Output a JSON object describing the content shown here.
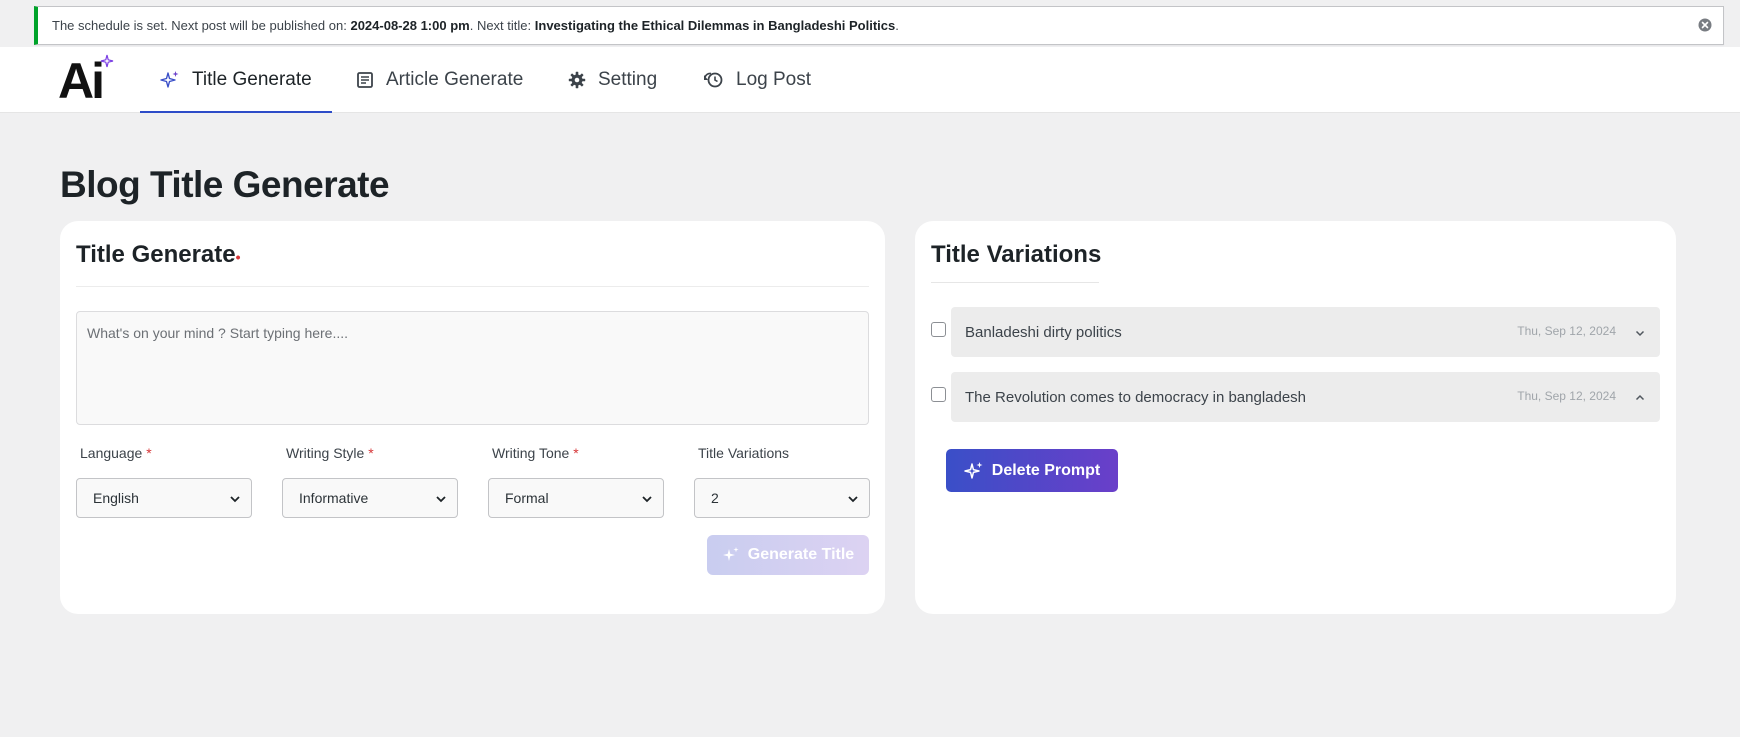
{
  "notice": {
    "prefix": "The schedule is set. Next post will be published on:",
    "datetime": "2024-08-28 1:00 pm",
    "mid": ". Next title:",
    "title": "Investigating the Ethical Dilemmas in Bangladeshi Politics",
    "suffix": "."
  },
  "logo": {
    "text": "Ai"
  },
  "nav": {
    "tabs": [
      {
        "label": "Title Generate",
        "icon": "sparkles-icon",
        "active": true
      },
      {
        "label": "Article Generate",
        "icon": "document-icon",
        "active": false
      },
      {
        "label": "Setting",
        "icon": "gear-icon",
        "active": false
      },
      {
        "label": "Log Post",
        "icon": "history-icon",
        "active": false
      }
    ]
  },
  "page": {
    "title": "Blog Title Generate"
  },
  "generator": {
    "title": "Title Generate",
    "required_mark": "•",
    "prompt_placeholder": "What's on your mind ? Start typing here....",
    "prompt_value": "",
    "fields": [
      {
        "label": "Language",
        "required": "*",
        "value": "English"
      },
      {
        "label": "Writing Style",
        "required": "*",
        "value": "Informative"
      },
      {
        "label": "Writing Tone",
        "required": "*",
        "value": "Formal"
      },
      {
        "label": "Title Variations",
        "required": "",
        "value": "2"
      }
    ],
    "generate_button": "Generate Title"
  },
  "variations": {
    "title": "Title Variations",
    "items": [
      {
        "text": "Banladeshi dirty politics",
        "date": "Thu, Sep 12, 2024",
        "expanded": false
      },
      {
        "text": "The Revolution comes to democracy in bangladesh",
        "date": "Thu, Sep 12, 2024",
        "expanded": true
      }
    ],
    "delete_button": "Delete Prompt"
  },
  "colors": {
    "accent": "#2d4cc8",
    "notice_success": "#00a32a",
    "required": "#d63638",
    "gradient_start": "#3a4fc8",
    "gradient_end": "#6a3fc9"
  }
}
